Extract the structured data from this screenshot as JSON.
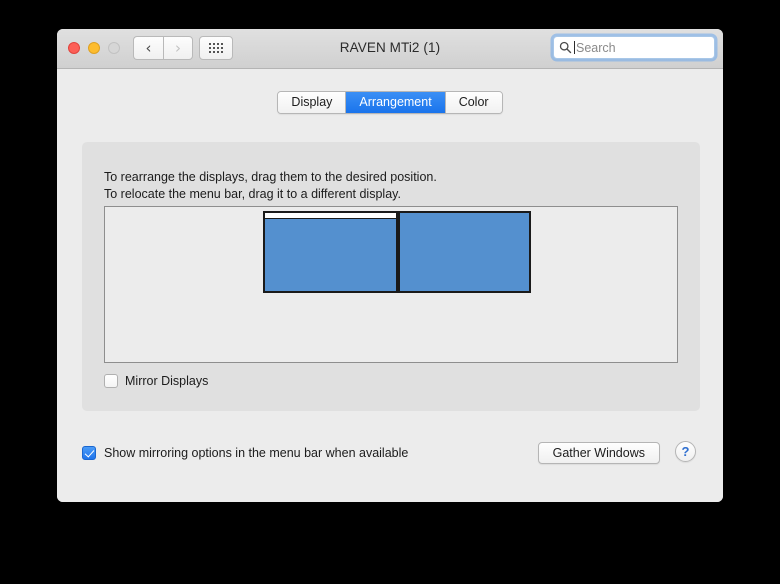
{
  "window": {
    "title": "RAVEN MTi2 (1)",
    "traffic_lights": [
      "close",
      "minimize",
      "zoom"
    ],
    "nav": {
      "back_icon": "chevron-left-icon",
      "forward_icon": "chevron-right-icon",
      "grid_icon": "grid-dots-icon"
    },
    "search": {
      "placeholder": "Search",
      "value": "",
      "icon": "search-icon"
    }
  },
  "tabs": [
    {
      "label": "Display",
      "active": false
    },
    {
      "label": "Arrangement",
      "active": true
    },
    {
      "label": "Color",
      "active": false
    }
  ],
  "panel": {
    "instruction_line_1": "To rearrange the displays, drag them to the desired position.",
    "instruction_line_2": "To relocate the menu bar, drag it to a different display.",
    "displays": [
      {
        "name": "primary-display",
        "has_menu_bar": true
      },
      {
        "name": "secondary-display",
        "has_menu_bar": false
      }
    ],
    "mirror_displays": {
      "label": "Mirror Displays",
      "checked": false
    }
  },
  "footer": {
    "show_mirroring": {
      "label": "Show mirroring options in the menu bar when available",
      "checked": true
    },
    "gather_windows_label": "Gather Windows",
    "help_label": "?"
  },
  "colors": {
    "display_fill": "#5490cf",
    "accent_blue": "#1f74ec",
    "help_blue": "#2f6fd0"
  }
}
